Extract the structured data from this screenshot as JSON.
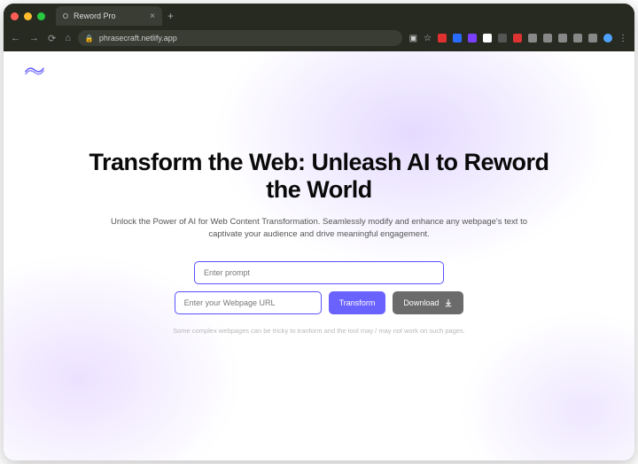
{
  "browser": {
    "tab_title": "Reword Pro",
    "url": "phrasecraft.netlify.app"
  },
  "hero": {
    "headline": "Transform the Web: Unleash AI to Reword the World",
    "subhead": "Unlock the Power of AI for Web Content Transformation. Seamlessly modify and enhance any webpage's text to captivate your audience and drive meaningful engagement."
  },
  "form": {
    "prompt_placeholder": "Enter prompt",
    "url_placeholder": "Enter your Webpage URL",
    "transform_label": "Transform",
    "download_label": "Download",
    "disclaimer": "Some complex webpages can be tricky to tranform and the tool may / may not work on such pages."
  },
  "colors": {
    "accent": "#5a52ff",
    "accent_btn": "#6a62ff",
    "secondary_btn": "#6b6b6b"
  }
}
